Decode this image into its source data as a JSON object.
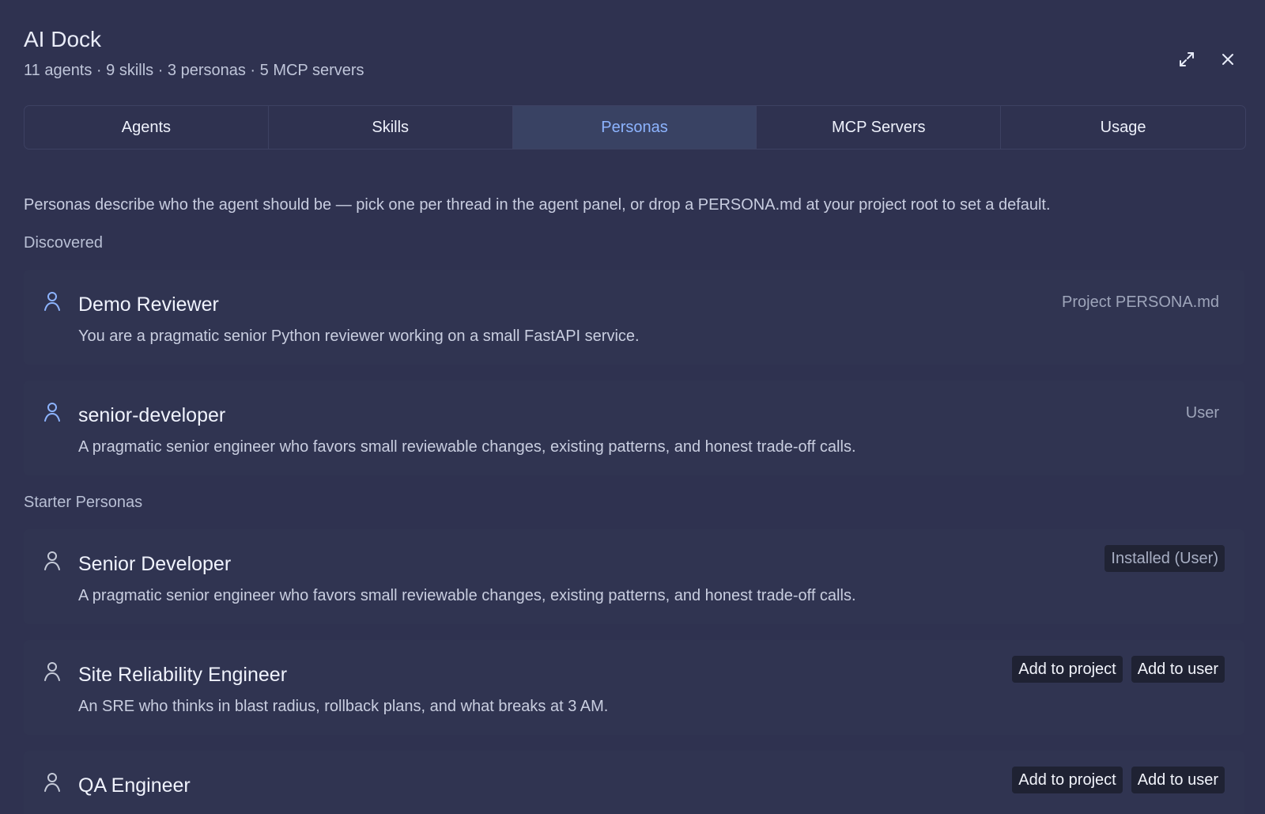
{
  "window": {
    "title": "AI Dock",
    "summary": "11 agents · 9 skills · 3 personas · 5 MCP servers",
    "icons": {
      "expand": "expand-icon",
      "close": "close-icon"
    }
  },
  "tabs": [
    {
      "label": "Agents",
      "active": false
    },
    {
      "label": "Skills",
      "active": false
    },
    {
      "label": "Personas",
      "active": true
    },
    {
      "label": "MCP Servers",
      "active": false
    },
    {
      "label": "Usage",
      "active": false
    }
  ],
  "personas_page": {
    "intro": "Personas describe who the agent should be — pick one per thread in the agent panel, or drop a PERSONA.md at your project root to set a default.",
    "discovered_label": "Discovered",
    "starter_label": "Starter Personas",
    "discovered": [
      {
        "name": "Demo Reviewer",
        "description": "You are a pragmatic senior Python reviewer working on a small FastAPI service.",
        "source": "Project PERSONA.md",
        "icon": "user-icon"
      },
      {
        "name": "senior-developer",
        "description": "A pragmatic senior engineer who favors small reviewable changes, existing patterns, and honest trade-off calls.",
        "source": "User",
        "icon": "user-icon"
      }
    ],
    "starters": [
      {
        "name": "Senior Developer",
        "description": "A pragmatic senior engineer who favors small reviewable changes, existing patterns, and honest trade-off calls.",
        "status": "Installed (User)",
        "icon": "user-icon"
      },
      {
        "name": "Site Reliability Engineer",
        "description": "An SRE who thinks in blast radius, rollback plans, and what breaks at 3 AM.",
        "actions": [
          "Add to project",
          "Add to user"
        ],
        "icon": "user-icon"
      },
      {
        "name": "QA Engineer",
        "description": "",
        "actions": [
          "Add to project",
          "Add to user"
        ],
        "icon": "user-icon"
      }
    ]
  },
  "colors": {
    "background": "#2f3250",
    "active_tab": "#394263",
    "accent": "#8db4ff",
    "button": "#1f2233"
  }
}
